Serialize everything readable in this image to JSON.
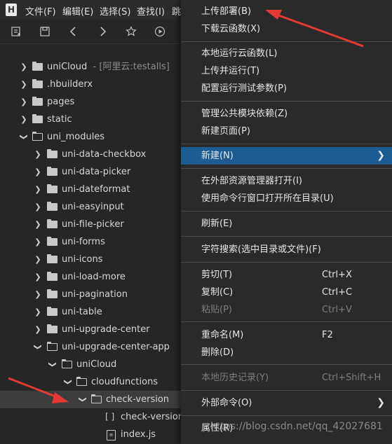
{
  "menubar": {
    "logo": "H",
    "items": [
      "文件(F)",
      "编辑(E)",
      "选择(S)",
      "查找(I)",
      "跳"
    ]
  },
  "toolbar": {
    "icons": [
      "new-file-icon",
      "save-icon",
      "back-icon",
      "forward-icon",
      "star-icon",
      "play-icon"
    ]
  },
  "tree": {
    "rows": [
      {
        "label": "uniCloud",
        "note": "- [阿里云:testalls]"
      },
      {
        "label": ".hbuilderx"
      },
      {
        "label": "pages"
      },
      {
        "label": "static"
      },
      {
        "label": "uni_modules"
      },
      {
        "label": "uni-data-checkbox"
      },
      {
        "label": "uni-data-picker"
      },
      {
        "label": "uni-dateformat"
      },
      {
        "label": "uni-easyinput"
      },
      {
        "label": "uni-file-picker"
      },
      {
        "label": "uni-forms"
      },
      {
        "label": "uni-icons"
      },
      {
        "label": "uni-load-more"
      },
      {
        "label": "uni-pagination"
      },
      {
        "label": "uni-table"
      },
      {
        "label": "uni-upgrade-center"
      },
      {
        "label": "uni-upgrade-center-app"
      },
      {
        "label": "uniCloud"
      },
      {
        "label": "cloudfunctions"
      },
      {
        "label": "check-version"
      },
      {
        "label": "check-version.j",
        "prefix": "[ ]"
      },
      {
        "label": "index.js"
      }
    ]
  },
  "menu": {
    "items": [
      {
        "label": "上传部署(B)"
      },
      {
        "label": "下载云函数(X)"
      },
      {
        "label": "本地运行云函数(L)"
      },
      {
        "label": "上传并运行(T)"
      },
      {
        "label": "配置运行测试参数(P)"
      },
      {
        "label": "管理公共模块依赖(Z)"
      },
      {
        "label": "新建页面(P)"
      },
      {
        "label": "新建(N)"
      },
      {
        "label": "在外部资源管理器打开(I)"
      },
      {
        "label": "使用命令行窗口打开所在目录(U)"
      },
      {
        "label": "刷新(E)"
      },
      {
        "label": "字符搜索(选中目录或文件)(F)"
      },
      {
        "label": "剪切(T)",
        "shortcut": "Ctrl+X"
      },
      {
        "label": "复制(C)",
        "shortcut": "Ctrl+C"
      },
      {
        "label": "粘贴(P)",
        "shortcut": "Ctrl+V"
      },
      {
        "label": "重命名(M)",
        "shortcut": "F2"
      },
      {
        "label": "删除(D)"
      },
      {
        "label": "本地历史记录(Y)",
        "shortcut": "Ctrl+Shift+H"
      },
      {
        "label": "外部命令(O)"
      },
      {
        "label": "属性(R)"
      }
    ]
  },
  "watermark": "https://blog.csdn.net/qq_42027681",
  "colors": {
    "menu_highlight": "#1c5c93",
    "selected_row": "#3c3c3c",
    "annotation_arrow": "#e53935"
  }
}
